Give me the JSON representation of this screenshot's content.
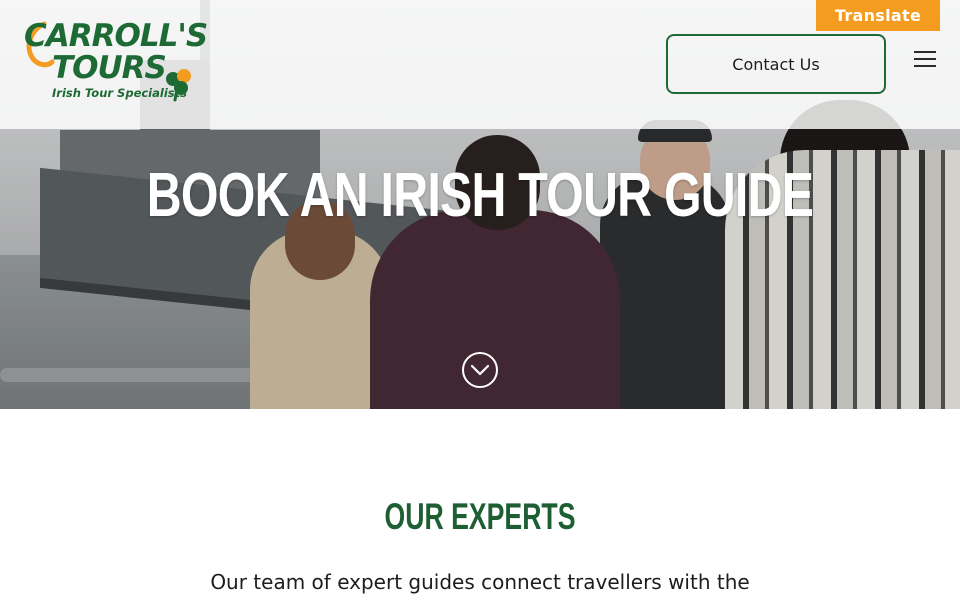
{
  "header": {
    "logo": {
      "line1": "CARROLL'S",
      "line2": "TOURS",
      "tagline": "Irish Tour Specialists"
    },
    "translate_label": "Translate",
    "contact_label": "Contact Us",
    "menu_icon": "hamburger-menu-icon"
  },
  "hero": {
    "title": "BOOK AN IRISH TOUR GUIDE",
    "scroll_icon": "chevron-down-circle-icon"
  },
  "main": {
    "section_heading": "OUR EXPERTS",
    "intro_text": "Our team of expert guides connect travellers with the"
  },
  "colors": {
    "brand_green": "#1d6a35",
    "heading_green": "#1d5e33",
    "translate_orange": "#f39c1f",
    "logo_orange": "#f39c1f"
  }
}
